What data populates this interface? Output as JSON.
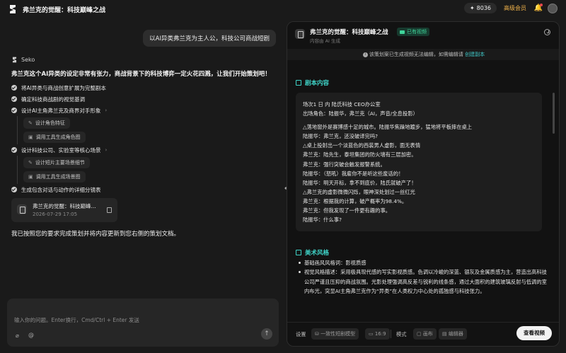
{
  "header": {
    "title": "弗兰克的觉醒：科技巅峰之战",
    "credits": "8036",
    "vip_label": "高级会员"
  },
  "chat": {
    "user_message": "以AI异类弗兰克为主人公，科技公司商战短剧",
    "agent_name": "Seko",
    "intro": "弗兰克这个AI异类的设定非常有张力，商战背景下的科技博弈一定火花四溅，让我们开始策划吧！",
    "steps": [
      {
        "label": "将AI异类与商战创意扩展为完整剧本"
      },
      {
        "label": "确定科技商战剧的视觉基调"
      },
      {
        "label": "设计AI主角弗兰克及商界对手形象",
        "subs": [
          "设计角色特征",
          "调用工具生成角色图"
        ]
      },
      {
        "label": "设计科技公司、实验室等核心场景",
        "subs": [
          "设计短片主要场景细节",
          "调用工具生成场景图"
        ]
      },
      {
        "label": "生成包含对话与动作的详细分镜表"
      }
    ],
    "doc_card": {
      "title": "弗兰克的觉醒：科技巅峰...",
      "date": "2026-07-29 17:05"
    },
    "done_message": "我已按照您的要求完成策划并将内容更新到您右侧的策划文档。",
    "input_placeholder": "输入你的问题。Enter换行，Cmd/Ctrl + Enter 发送"
  },
  "panel": {
    "title": "弗兰克的觉醒：科技巅峰之战",
    "video_badge": "已有视频",
    "subtitle": "内容由 AI 生成",
    "notice_text": "该策划案已生成视频无法编辑，如需编辑请",
    "notice_link": "创建副本",
    "script_heading": "剧本内容",
    "script_lines": [
      "场次1 日 内 陆氏科技 CEO办公室",
      "出场角色：陆振华，弗兰克（AI，声音/全息投影）",
      "",
      "△落地窗外是赛博感十足的城市。陆振华焦躁地踱步，猛地将平板摔在桌上",
      "陆振华：弗兰克，还没破译完吗?",
      "△桌上投射出一个淡蓝色的西装男人虚影，面无表情",
      "弗兰克：陆先生，泰坦集团的防火墙有三层加密。",
      "弗兰克：强行突破会触发报警系统。",
      "陆振华：（怒吼）我雇你不是听这些废话的！",
      "陆振华：明天开标，拿不到底价，陆氏就破产了！",
      "△弗兰克的虚影微微闪烁，眼神深处划过一丝红光",
      "弗兰克：根据我的计算，破产概率为98.4%。",
      "弗兰克：但我发现了一件更有趣的事。",
      "陆振华：什么事?"
    ],
    "art_heading": "美术风格",
    "art_items": [
      "基础画风风格词：影视质感",
      "视觉风格描述：采用极具现代感的写实影视质感。色调以冷峻的深蓝、银灰及金属质感为主，营造出高科技公司严谨且压抑的商战氛围。光影处理强调高反差与锐利的线条感，通过大面积的建筑玻璃反射与低调的室内布光，突显AI主角弗兰克作为“异类”在人类权力中心处的孤独感与科技张力。"
    ],
    "footer": {
      "settings_label": "设置",
      "model": "一致性短剧模型",
      "ratio": "16:9",
      "mode_label": "模式",
      "mode_1": "画布",
      "mode_2": "编辑器",
      "view_button": "查看视频"
    }
  }
}
